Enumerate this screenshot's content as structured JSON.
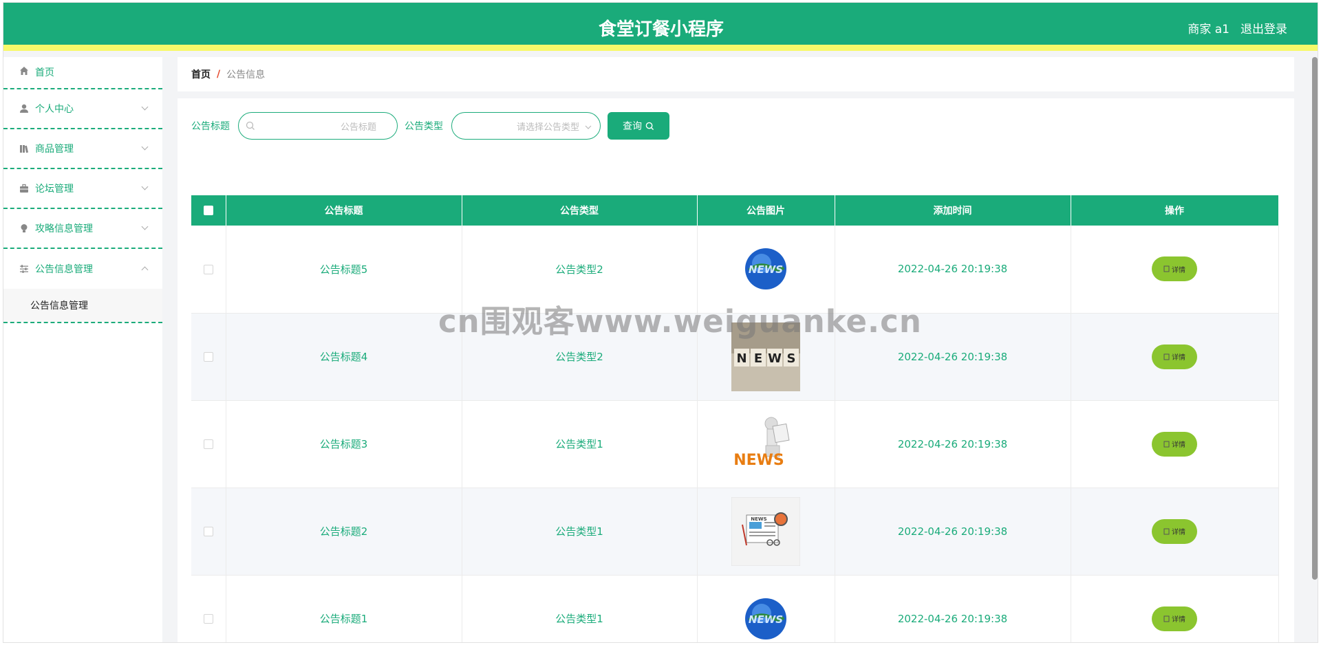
{
  "header": {
    "title": "食堂订餐小程序",
    "user": "商家 a1",
    "logout": "退出登录"
  },
  "sidebar": {
    "items": [
      {
        "label": "首页",
        "icon": "home-icon"
      },
      {
        "label": "个人中心",
        "icon": "user-icon"
      },
      {
        "label": "商品管理",
        "icon": "books-icon"
      },
      {
        "label": "论坛管理",
        "icon": "briefcase-icon"
      },
      {
        "label": "攻略信息管理",
        "icon": "lightbulb-icon"
      },
      {
        "label": "公告信息管理",
        "icon": "sliders-icon"
      }
    ],
    "sub_items": [
      {
        "label": "公告信息管理"
      }
    ]
  },
  "breadcrumb": {
    "home": "首页",
    "separator": "/",
    "current": "公告信息"
  },
  "search": {
    "title_label": "公告标题",
    "title_placeholder": "公告标题",
    "type_label": "公告类型",
    "type_placeholder": "请选择公告类型",
    "query_button": "查询"
  },
  "table": {
    "headers": [
      "公告标题",
      "公告类型",
      "公告图片",
      "添加时间",
      "操作"
    ],
    "rows": [
      {
        "title": "公告标题5",
        "type": "公告类型2",
        "image": "globe-news-image",
        "time": "2022-04-26 20:19:38",
        "action": "详情"
      },
      {
        "title": "公告标题4",
        "type": "公告类型2",
        "image": "news-cubes-image",
        "time": "2022-04-26 20:19:38",
        "action": "详情"
      },
      {
        "title": "公告标题3",
        "type": "公告类型1",
        "image": "news-figure-image",
        "time": "2022-04-26 20:19:38",
        "action": "详情"
      },
      {
        "title": "公告标题2",
        "type": "公告类型1",
        "image": "newspaper-image",
        "time": "2022-04-26 20:19:38",
        "action": "详情"
      },
      {
        "title": "公告标题1",
        "type": "公告类型1",
        "image": "globe-news-image",
        "time": "2022-04-26 20:19:38",
        "action": "详情"
      }
    ]
  },
  "watermark": "cn围观客www.weiguanke.cn",
  "colors": {
    "primary": "#1aab7a",
    "accent_bar": "#f7f96a",
    "detail_button": "#8bc52f"
  }
}
